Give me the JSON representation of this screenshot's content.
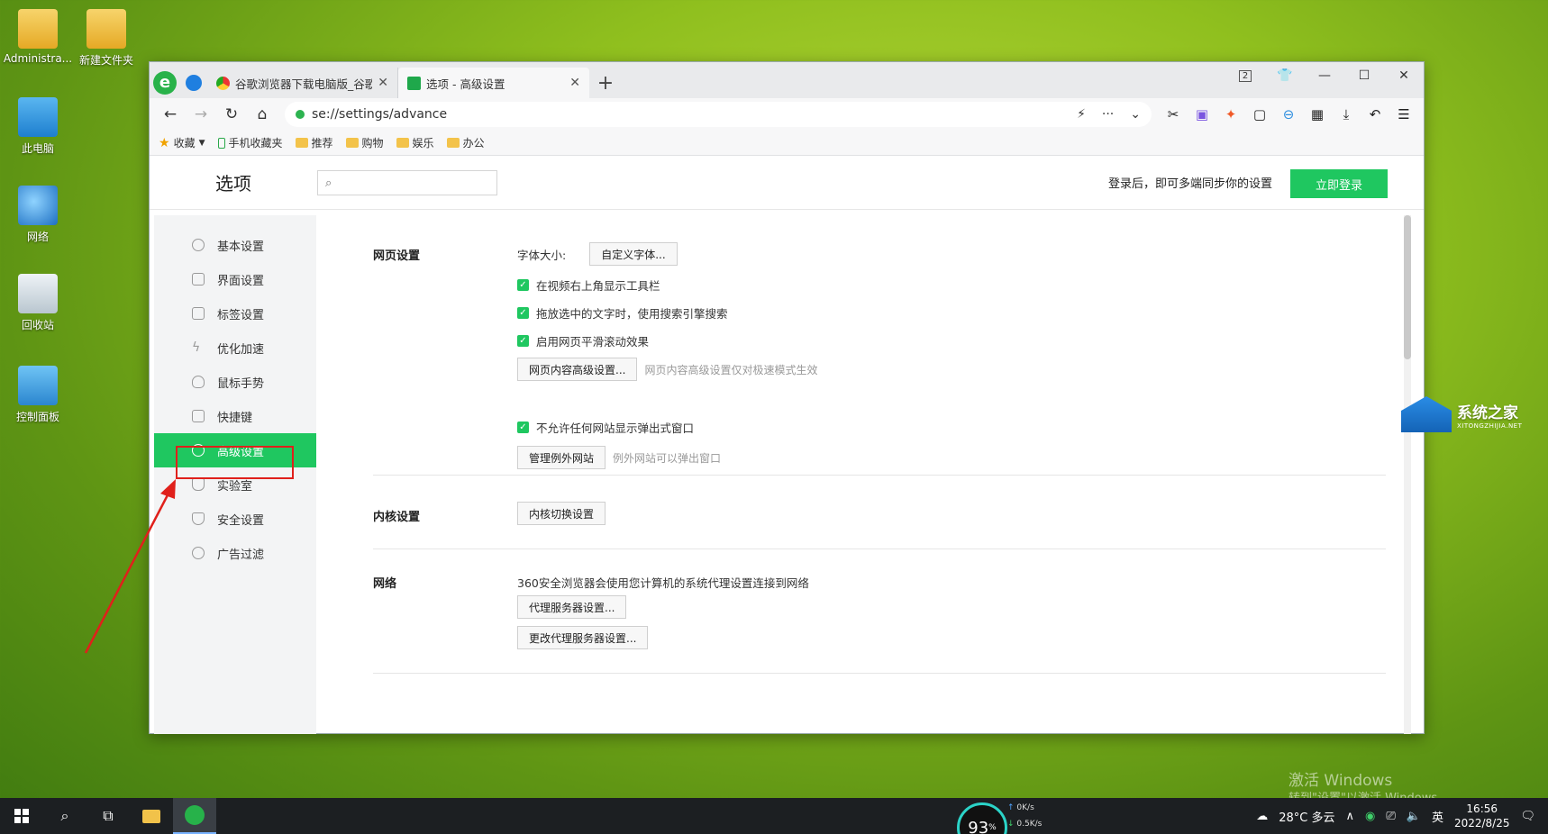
{
  "desktop": {
    "icons": [
      {
        "label": "Administra..."
      },
      {
        "label": "新建文件夹"
      },
      {
        "label": "此电脑"
      },
      {
        "label": "网络"
      },
      {
        "label": "回收站"
      },
      {
        "label": "控制面板"
      }
    ]
  },
  "browser": {
    "tabs": [
      {
        "title": "谷歌浏览器下载电脑版_谷歌浏"
      },
      {
        "title": "选项 - 高级设置"
      }
    ],
    "close_glyph": "✕",
    "new_tab_glyph": "+",
    "tab_count": "2",
    "address": "se://settings/advance",
    "bookmarks": {
      "favorites": "收藏",
      "items": [
        "手机收藏夹",
        "推荐",
        "购物",
        "娱乐",
        "办公"
      ]
    }
  },
  "settings": {
    "title": "选项",
    "search_placeholder": "",
    "login_hint": "登录后，即可多端同步你的设置",
    "login_button": "立即登录",
    "sidebar": [
      {
        "label": "基本设置"
      },
      {
        "label": "界面设置"
      },
      {
        "label": "标签设置"
      },
      {
        "label": "优化加速"
      },
      {
        "label": "鼠标手势"
      },
      {
        "label": "快捷键"
      },
      {
        "label": "高级设置"
      },
      {
        "label": "实验室"
      },
      {
        "label": "安全设置"
      },
      {
        "label": "广告过滤"
      }
    ],
    "webpage": {
      "label": "网页设置",
      "font_size_label": "字体大小:",
      "font_button": "自定义字体...",
      "opt1": "在视频右上角显示工具栏",
      "opt2": "拖放选中的文字时，使用搜索引擎搜索",
      "opt3": "启用网页平滑滚动效果",
      "advanced_button": "网页内容高级设置...",
      "advanced_note": "网页内容高级设置仅对极速模式生效",
      "opt4": "不允许任何网站显示弹出式窗口",
      "manage_button": "管理例外网站",
      "manage_note": "例外网站可以弹出窗口"
    },
    "kernel": {
      "label": "内核设置",
      "button": "内核切换设置"
    },
    "network": {
      "label": "网络",
      "desc": "360安全浏览器会使用您计算机的系统代理设置连接到网络",
      "proxy_button": "代理服务器设置...",
      "change_proxy_button": "更改代理服务器设置..."
    }
  },
  "watermark": {
    "title": "系统之家",
    "subtitle": "XITONGZHIJIA.NET"
  },
  "activate": {
    "line1": "激活 Windows",
    "line2": "转到\"设置\"以激活 Windows"
  },
  "taskbar": {
    "gauge_value": "93",
    "gauge_unit": "%",
    "up_speed": "0K/s",
    "down_speed": "0.5K/s",
    "weather": "28°C 多云",
    "ime": "英",
    "time": "16:56",
    "date": "2022/8/25",
    "notif_count": "1"
  },
  "colors": {
    "accent_green": "#1fc760",
    "highlight_red": "#e0201b"
  }
}
